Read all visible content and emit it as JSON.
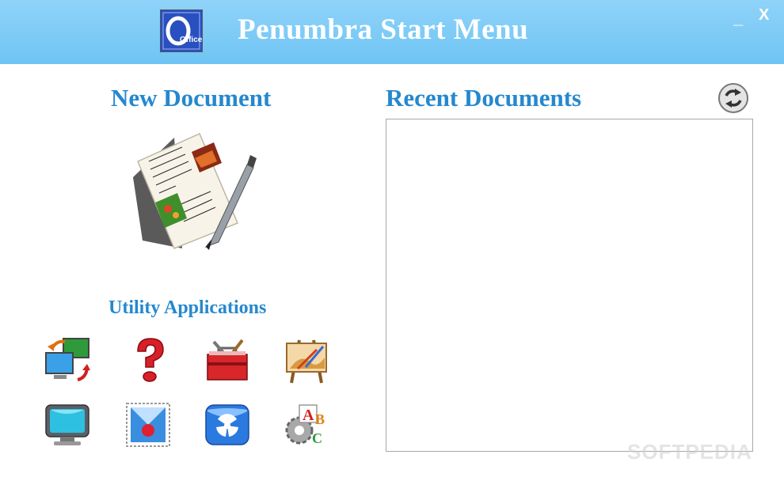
{
  "window": {
    "title": "Penumbra Start Menu",
    "logo_text": "Office",
    "minimize_label": "_",
    "close_label": "X"
  },
  "new_document": {
    "heading": "New Document",
    "icon": "document-pen-icon"
  },
  "recent_documents": {
    "heading": "Recent Documents",
    "refresh_icon": "refresh-icon",
    "items": []
  },
  "utility": {
    "heading": "Utility Applications",
    "apps": [
      {
        "icon": "network-transfer-icon"
      },
      {
        "icon": "help-question-icon"
      },
      {
        "icon": "toolbox-icon"
      },
      {
        "icon": "easel-paint-icon"
      },
      {
        "icon": "monitor-icon"
      },
      {
        "icon": "mail-stamp-icon"
      },
      {
        "icon": "radiation-icon"
      },
      {
        "icon": "font-tools-icon"
      }
    ]
  },
  "watermark": "SOFTPEDIA",
  "colors": {
    "titlebar": "#7ccbf6",
    "heading": "#2488cf"
  }
}
